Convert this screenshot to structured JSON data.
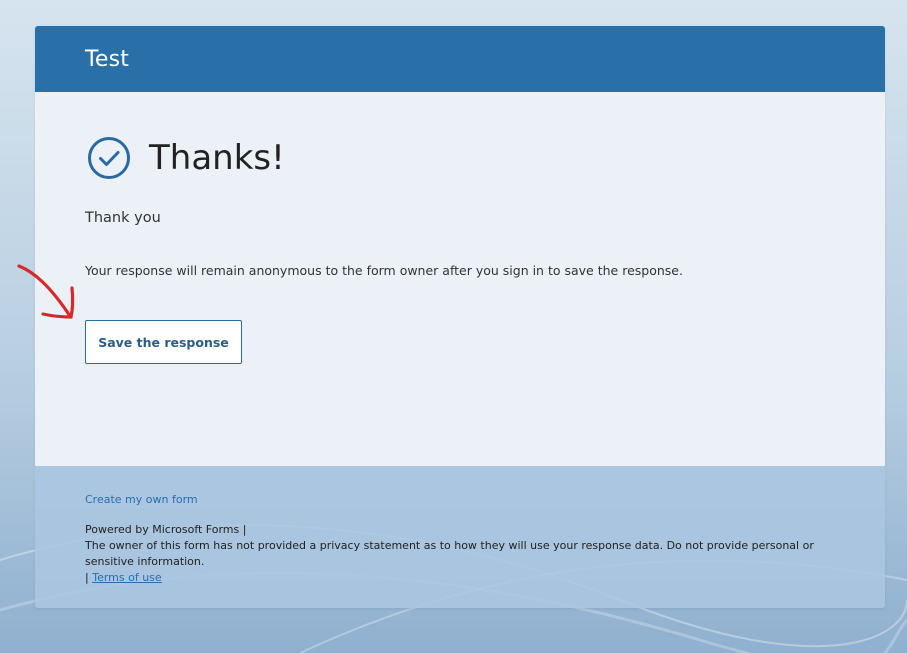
{
  "form": {
    "title": "Test"
  },
  "confirmation": {
    "heading": "Thanks!",
    "message": "Thank you",
    "anonymous_notice": "Your response will remain anonymous to the form owner after you sign in to save the response.",
    "save_button_label": "Save the response"
  },
  "footer": {
    "create_link": "Create my own form",
    "powered_by": "Powered by Microsoft Forms |",
    "privacy_statement": "The owner of this form has not provided a privacy statement as to how they will use your response data. Do not provide personal or sensitive information.",
    "terms_separator": "|",
    "terms_link": "Terms of use"
  },
  "colors": {
    "header_bg": "#2970a9",
    "body_bg": "#ebf1f7",
    "footer_bg": "#acc7e0",
    "accent": "#2a6aa3",
    "annotation_arrow": "#d42a2a"
  },
  "icons": {
    "confirmation": "check-circle-icon",
    "annotation": "red-arrow-annotation"
  }
}
